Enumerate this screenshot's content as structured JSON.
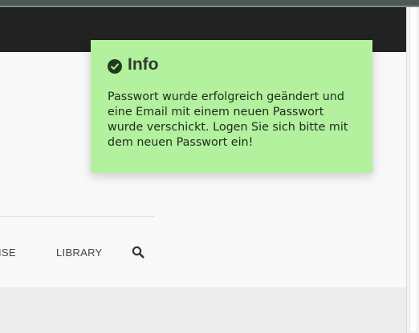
{
  "navigation": {
    "items": [
      {
        "label": "ISE"
      },
      {
        "label": "LIBRARY"
      }
    ],
    "search_icon": "search-icon"
  },
  "notification": {
    "title": "Info",
    "icon": "check-circle-icon",
    "message": "Passwort wurde erfolgreich geändert und eine Email mit einem neuen Passwort wurde verschickt. Logen Sie sich bitte mit dem neuen Passwort ein!",
    "background_color": "#b3f19e"
  },
  "colors": {
    "header": "#222222",
    "page": "#f8f8f8",
    "window_chrome": "#4b5a52"
  }
}
